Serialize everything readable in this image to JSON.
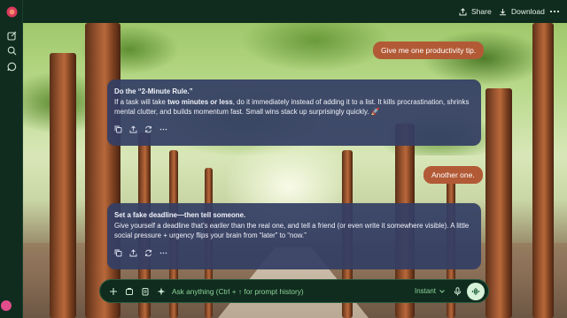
{
  "topbar": {
    "share_label": "Share",
    "download_label": "Download",
    "more_icon": "more-icon"
  },
  "rail": {
    "icons": [
      "app-logo-icon",
      "new-chat-icon",
      "search-icon",
      "chats-icon"
    ],
    "avatar_icon": "avatar"
  },
  "conversation": {
    "user_messages": [
      "Give me one productivity tip.",
      "Another one."
    ],
    "responses": [
      {
        "title": "Do the “2-Minute Rule.”",
        "text_before": "If a task will take ",
        "text_bold": "two minutes or less",
        "text_after": ", do it immediately instead of adding it to a list. It kills procrastination, shrinks mental clutter, and builds momentum fast. Small wins stack up surprisingly quickly. 🚀"
      },
      {
        "title": "Set a fake deadline—then tell someone.",
        "text_before": "Give yourself a deadline that’s ",
        "text_italic": "earlier",
        "text_after": " than the real one, and tell a friend (or even write it somewhere visible). A little social pressure + urgency flips your brain from “later” to “now.”"
      }
    ],
    "action_icons": [
      "copy-icon",
      "share-icon",
      "regenerate-icon",
      "more-icon"
    ]
  },
  "prompt": {
    "placeholder": "Ask anything (Ctrl + ↑ for prompt history)",
    "mode_label": "Instant",
    "left_icons": [
      "add-icon",
      "attach-icon",
      "notes-icon",
      "sparkle-icon"
    ],
    "right_icons": [
      "chevron-down-icon",
      "microphone-icon",
      "voice-icon"
    ]
  },
  "colors": {
    "chrome": "#0f2c1e",
    "user_bubble": "#b25a36",
    "response_card": "#343e64",
    "accent_text": "#8fd29a"
  }
}
